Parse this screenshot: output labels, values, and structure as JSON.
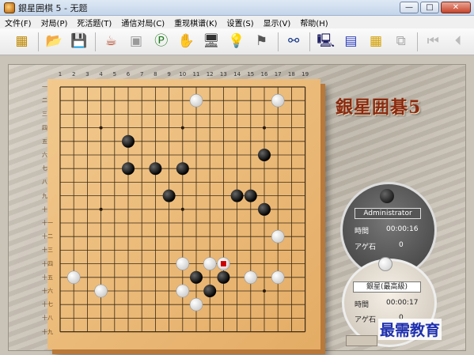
{
  "window": {
    "title": "銀星囲棋 5 - 无题",
    "minimize": "—",
    "maximize": "□",
    "close": "✕"
  },
  "menu": [
    "文件(F)",
    "对局(P)",
    "死活题(T)",
    "通信对局(C)",
    "重现棋谱(K)",
    "设置(S)",
    "显示(V)",
    "帮助(H)"
  ],
  "toolbar": [
    {
      "name": "board-size-icon",
      "glyph": "▦",
      "color": "#c08a00"
    },
    {
      "name": "sep"
    },
    {
      "name": "open-folder-icon",
      "glyph": "📂",
      "color": "#c9a040"
    },
    {
      "name": "save-disk-icon",
      "glyph": "💾",
      "color": "#222"
    },
    {
      "name": "sep"
    },
    {
      "name": "tea-cup-icon",
      "glyph": "☕",
      "color": "#b04020"
    },
    {
      "name": "undo-stones-icon",
      "glyph": "▣",
      "color": "#9a9a9a"
    },
    {
      "name": "pass-icon",
      "glyph": "Ⓟ",
      "color": "#1a7a1a"
    },
    {
      "name": "resign-hand-icon",
      "glyph": "✋",
      "color": "#e8b000"
    },
    {
      "name": "analysis-monitor-icon",
      "glyph": "🖥",
      "color": "#333"
    },
    {
      "name": "hint-bulb-icon",
      "glyph": "💡",
      "color": "#e6c200"
    },
    {
      "name": "flag-icon",
      "glyph": "⚑",
      "color": "#555"
    },
    {
      "name": "sep"
    },
    {
      "name": "stones-swap-icon",
      "glyph": "⚯",
      "color": "#1a3a8a"
    },
    {
      "name": "sep"
    },
    {
      "name": "network-monitor-icon",
      "glyph": "🖳",
      "color": "#226"
    },
    {
      "name": "kifu-chart-icon",
      "glyph": "▤",
      "color": "#2a3cc0"
    },
    {
      "name": "board-grid-icon",
      "glyph": "▦",
      "color": "#d4a000"
    },
    {
      "name": "window-arrange-icon",
      "glyph": "⧉",
      "color": "#aaa"
    },
    {
      "name": "sep"
    },
    {
      "name": "first-move-icon",
      "glyph": "⏮",
      "color": "#bbb"
    },
    {
      "name": "prev-move-icon",
      "glyph": "⏴",
      "color": "#bbb"
    }
  ],
  "board": {
    "columns": [
      "1",
      "2",
      "3",
      "4",
      "5",
      "6",
      "7",
      "8",
      "9",
      "10",
      "11",
      "12",
      "13",
      "14",
      "15",
      "16",
      "17",
      "18",
      "19"
    ],
    "rows": [
      "一",
      "二",
      "三",
      "四",
      "五",
      "六",
      "七",
      "八",
      "九",
      "十",
      "十一",
      "十二",
      "十三",
      "十四",
      "十五",
      "十六",
      "十七",
      "十八",
      "十九"
    ],
    "black_stones": [
      [
        6,
        5
      ],
      [
        6,
        7
      ],
      [
        8,
        7
      ],
      [
        10,
        7
      ],
      [
        9,
        9
      ],
      [
        15,
        9
      ],
      [
        14,
        9
      ],
      [
        16,
        10
      ],
      [
        16,
        6
      ],
      [
        11,
        15
      ],
      [
        13,
        15
      ],
      [
        12,
        16
      ]
    ],
    "white_stones": [
      [
        11,
        2
      ],
      [
        17,
        2
      ],
      [
        17,
        12
      ],
      [
        10,
        14
      ],
      [
        12,
        14
      ],
      [
        2,
        15
      ],
      [
        15,
        15
      ],
      [
        17,
        15
      ],
      [
        4,
        16
      ],
      [
        10,
        16
      ],
      [
        11,
        17
      ]
    ],
    "last_move": [
      13,
      14
    ],
    "last_move_color": "#cc0000"
  },
  "logo": "銀星囲碁5",
  "black_player": {
    "name": "Administrator",
    "time_label": "時間",
    "time": "00:00:16",
    "captures_label": "アゲ石",
    "captures": "0"
  },
  "white_player": {
    "name": "銀星(最高級)",
    "time_label": "時間",
    "time": "00:00:17",
    "captures_label": "アゲ石",
    "captures": "0"
  },
  "watermark": "最需教育"
}
